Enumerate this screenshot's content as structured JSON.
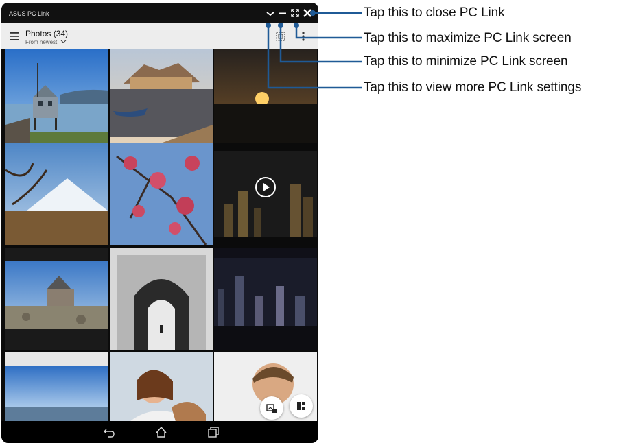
{
  "window": {
    "title": "ASUS PC Link"
  },
  "window_controls": [
    {
      "icon": "chevron-down-icon"
    },
    {
      "icon": "minimize-icon"
    },
    {
      "icon": "maximize-icon"
    },
    {
      "icon": "close-icon"
    }
  ],
  "toolbar": {
    "menu_icon": "hamburger-menu-icon",
    "title": "Photos (34)",
    "sort_label": "From newest",
    "select_icon": "select-icon",
    "more_icon": "more-vert-icon"
  },
  "gallery": {
    "photos": [
      "pier-house-lake",
      "castle-harbor-sunset",
      "sunset-silhouette",
      "snowy-mountain-branches",
      "plum-blossoms",
      "city-night-video",
      "stone-church-lake",
      "stone-archway-bw",
      "city-skyline-night",
      "coastal-landscape",
      "woman-scarf-portrait",
      "smiling-man-portrait"
    ],
    "video_icon": "play-icon"
  },
  "fabs": [
    {
      "icon": "gallery-edit-icon"
    },
    {
      "icon": "layout-grid-icon"
    }
  ],
  "navbar": [
    {
      "icon": "back-icon"
    },
    {
      "icon": "home-icon"
    },
    {
      "icon": "recent-apps-icon"
    }
  ],
  "callouts": [
    {
      "text": "Tap this to close PC Link"
    },
    {
      "text": "Tap this to maximize PC Link screen"
    },
    {
      "text": "Tap this to minimize PC Link screen"
    },
    {
      "text": "Tap this to view more PC Link settings"
    }
  ],
  "colors": {
    "callout_line": "#1f5a96",
    "titlebar": "#111111",
    "toolbar": "#ededed"
  }
}
